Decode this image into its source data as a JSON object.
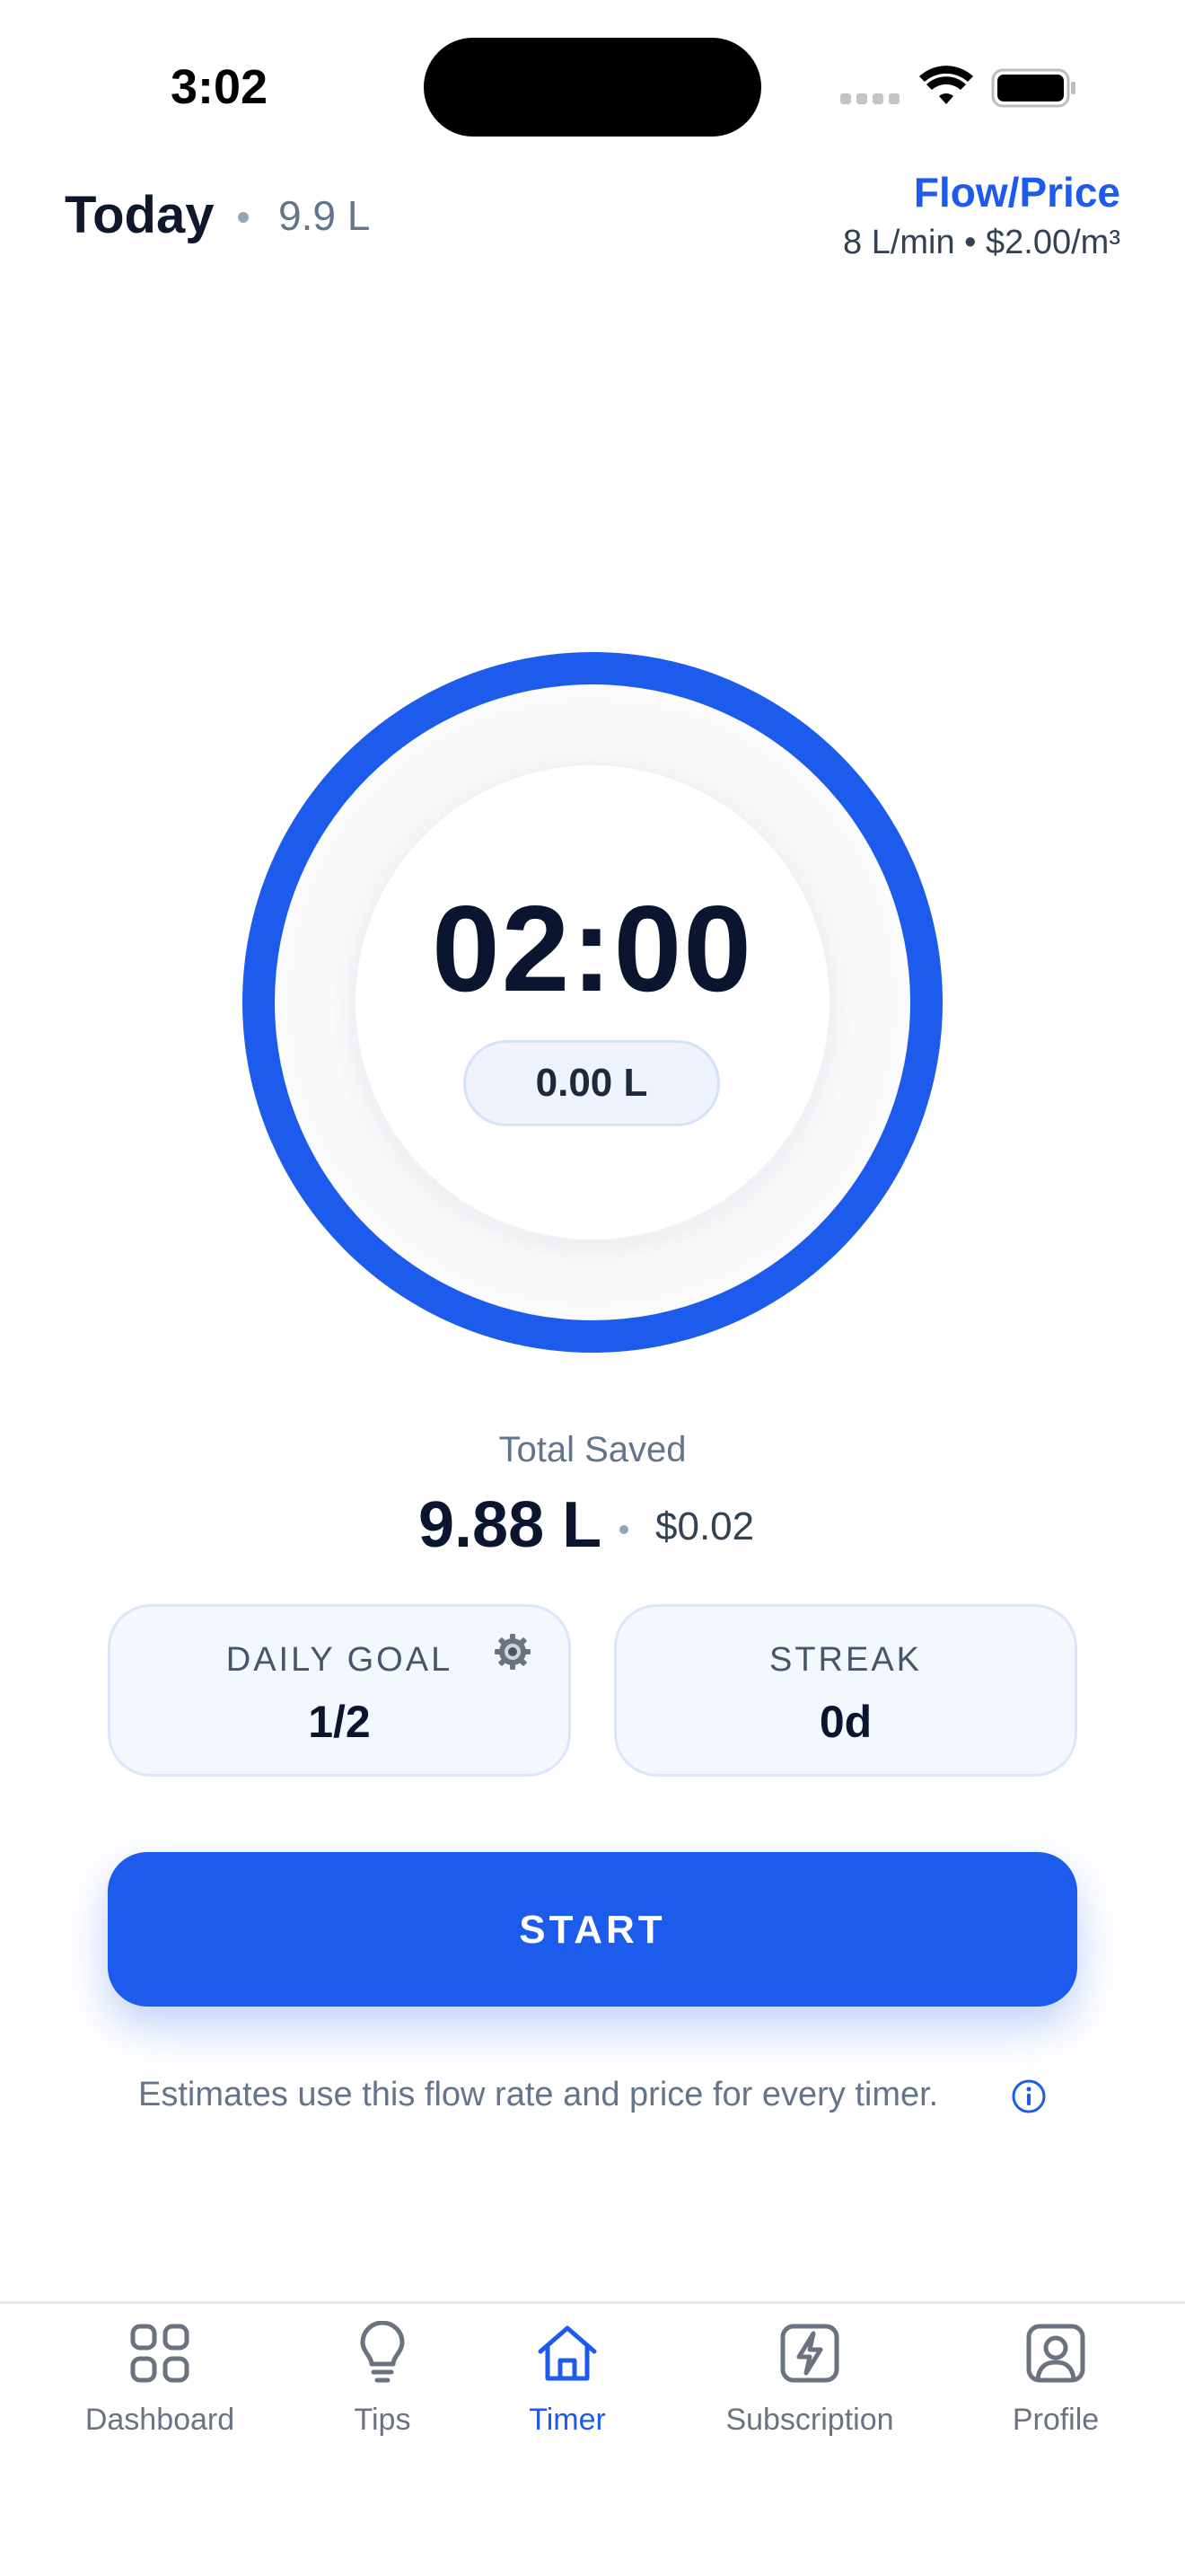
{
  "status_bar": {
    "time": "3:02"
  },
  "header": {
    "today_label": "Today",
    "today_value": "9.9 L",
    "flowprice_link": "Flow/Price",
    "flowprice_summary": "8 L/min • $2.00/m³"
  },
  "timer": {
    "time_remaining": "02:00",
    "liters_used": "0.00 L"
  },
  "totals": {
    "label": "Total Saved",
    "liters": "9.88 L",
    "money": "$0.02"
  },
  "cards": {
    "daily_goal": {
      "title": "DAILY GOAL",
      "value": "1/2",
      "icon": "gear-icon"
    },
    "streak": {
      "title": "STREAK",
      "value": "0d"
    }
  },
  "start_button": {
    "label": "START"
  },
  "note": {
    "text": "Estimates use this flow rate and price for every timer.",
    "icon": "info-icon"
  },
  "tabs": [
    {
      "label": "Dashboard",
      "icon": "grid-icon",
      "active": false
    },
    {
      "label": "Tips",
      "icon": "lightbulb-icon",
      "active": false
    },
    {
      "label": "Timer",
      "icon": "home-icon",
      "active": true
    },
    {
      "label": "Subscription",
      "icon": "lightning-icon",
      "active": false
    },
    {
      "label": "Profile",
      "icon": "profile-icon",
      "active": false
    }
  ],
  "colors": {
    "accent": "#1d5bed",
    "text_primary": "#0b1530",
    "text_secondary": "#64748b",
    "card_bg": "#f3f7fe",
    "card_border": "#dbe6fb"
  }
}
